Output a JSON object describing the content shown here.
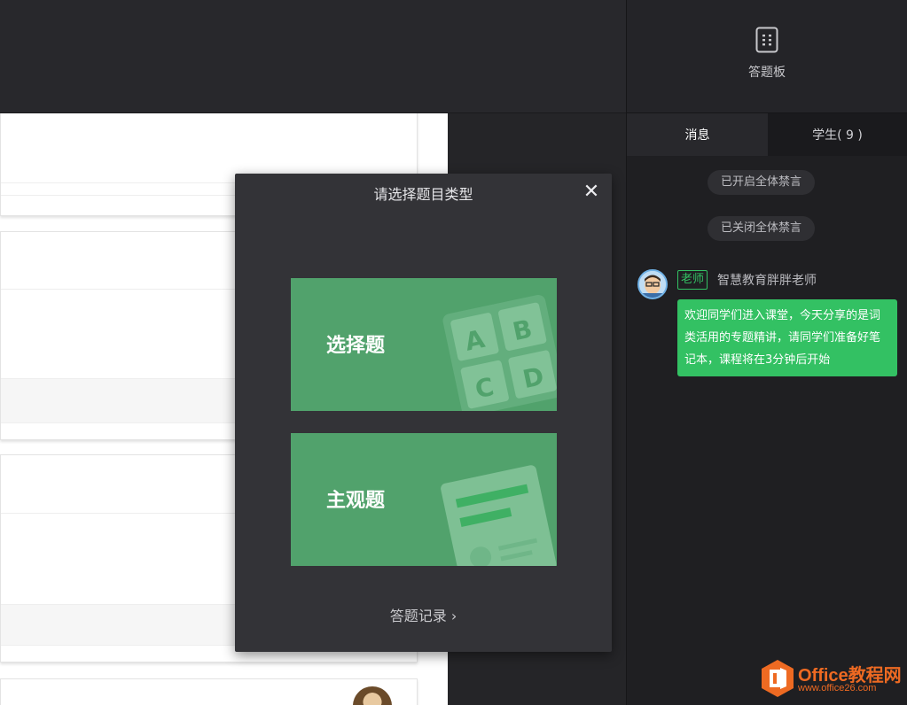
{
  "header": {
    "answer_board_label": "答题板"
  },
  "chat": {
    "tabs": [
      {
        "label": "消息",
        "active": true
      },
      {
        "label": "学生( 9 )",
        "active": false
      }
    ],
    "system_messages": [
      "已开启全体禁言",
      "已关闭全体禁言"
    ],
    "message": {
      "role_tag": "老师",
      "sender": "智慧教育胖胖老师",
      "text": "欢迎同学们进入课堂，今天分享的是词类活用的专题精讲，请同学们准备好笔记本，课程将在3分钟后开始"
    }
  },
  "modal": {
    "title": "请选择题目类型",
    "close_symbol": "✕",
    "options": [
      {
        "label": "选择题",
        "icon": "abcd-grid-icon"
      },
      {
        "label": "主观题",
        "icon": "document-icon"
      }
    ],
    "record_label": "答题记录 ›",
    "letters": [
      "A",
      "B",
      "C",
      "D"
    ]
  },
  "watermark": {
    "title": "Office教程网",
    "url": "www.office26.com"
  },
  "colors": {
    "accent_green": "#33c163",
    "option_green": "#51a26c",
    "watermark_orange": "#ee6a22"
  }
}
